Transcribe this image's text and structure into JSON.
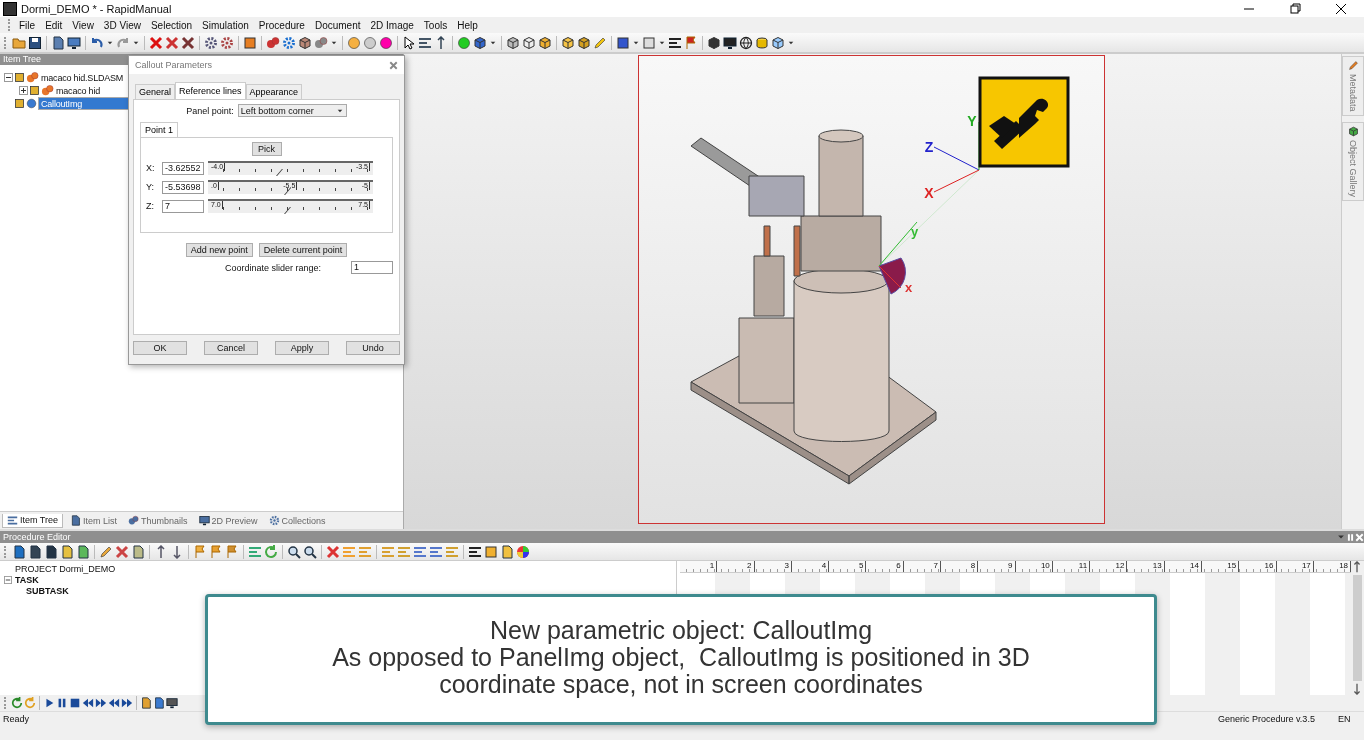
{
  "window": {
    "title": "Dormi_DEMO * - RapidManual"
  },
  "menu": [
    "File",
    "Edit",
    "View",
    "3D View",
    "Selection",
    "Simulation",
    "Procedure",
    "Document",
    "2D Image",
    "Tools",
    "Help"
  ],
  "item_tree": {
    "title": "Item Tree",
    "items": [
      {
        "label": "macaco hid.SLDASM",
        "kind": "assembly",
        "expanded": true,
        "selected": false,
        "children": [
          {
            "label": "macaco hid",
            "kind": "assembly",
            "expanded": false,
            "selected": false
          }
        ]
      },
      {
        "label": "CalloutImg",
        "kind": "callout",
        "selected": true
      }
    ]
  },
  "left_tabs": [
    {
      "label": "Item Tree",
      "kind": "tree",
      "selected": true
    },
    {
      "label": "Item List",
      "kind": "list",
      "selected": false
    },
    {
      "label": "Thumbnails",
      "kind": "thumbs",
      "selected": false
    },
    {
      "label": "2D Preview",
      "kind": "preview",
      "selected": false
    },
    {
      "label": "Collections",
      "kind": "collections",
      "selected": false
    }
  ],
  "dialog": {
    "title": "Callout Parameters",
    "tabs": [
      {
        "label": "General",
        "selected": false
      },
      {
        "label": "Reference lines",
        "selected": true
      },
      {
        "label": "Appearance",
        "selected": false
      }
    ],
    "panel_point_label": "Panel point:",
    "panel_point_value": "Left bottom corner",
    "point_tabs": [
      {
        "label": "Point 1",
        "selected": true
      }
    ],
    "pick_button": "Pick",
    "coordinates": [
      {
        "label": "X:",
        "value": "-3.62552",
        "level": 0.43,
        "scale": [
          "-4.0",
          "-3.5"
        ]
      },
      {
        "label": "Y:",
        "value": "-5.53698",
        "level": 0.48,
        "scale": [
          ".0",
          "-5.5",
          "-5"
        ]
      },
      {
        "label": "Z:",
        "value": "7",
        "level": 0.48,
        "scale": [
          "7.0",
          "7.5"
        ]
      }
    ],
    "point_buttons": [
      "Add new point",
      "Delete current point"
    ],
    "range_label": "Coordinate slider range:",
    "range_value": "1",
    "buttons": [
      "OK",
      "Cancel",
      "Apply",
      "Undo"
    ]
  },
  "viewport": {
    "axes": [
      {
        "label": "Z",
        "kind": "z",
        "color": "#2222cc"
      },
      {
        "label": "X",
        "kind": "x",
        "color": "#dd2222"
      },
      {
        "label": "Y",
        "kind": "y",
        "color": "#22aa22"
      }
    ],
    "gizmo_labels": [
      {
        "label": "y",
        "kind": "y",
        "color": "#33bb33"
      },
      {
        "label": "x",
        "kind": "x",
        "color": "#dd3333"
      }
    ]
  },
  "side_tabs": [
    {
      "label": "Metadata",
      "kind": "metadata"
    },
    {
      "label": "Object Gallery",
      "kind": "gallery"
    }
  ],
  "procedure_editor": {
    "title": "Procedure Editor",
    "tree": [
      {
        "label": "PROJECT Dormi_DEMO",
        "kind": "project"
      },
      {
        "label": "TASK",
        "kind": "task",
        "expanded": true,
        "children": [
          {
            "label": "SUBTASK",
            "kind": "subtask"
          }
        ]
      }
    ],
    "ruler": [
      "1",
      "2",
      "3",
      "4",
      "5",
      "6",
      "7",
      "8",
      "9",
      "10",
      "11",
      "12",
      "13",
      "14",
      "15",
      "16",
      "17",
      "18"
    ]
  },
  "caption": {
    "lines": [
      "New parametric object: CalloutImg",
      "As opposed to PanelImg object,  CalloutImg is positioned in 3D",
      "coordinate space, not in screen coordinates"
    ]
  },
  "status_bar": {
    "status": "Ready",
    "version": "Generic Procedure v.3.5",
    "language": "EN"
  }
}
